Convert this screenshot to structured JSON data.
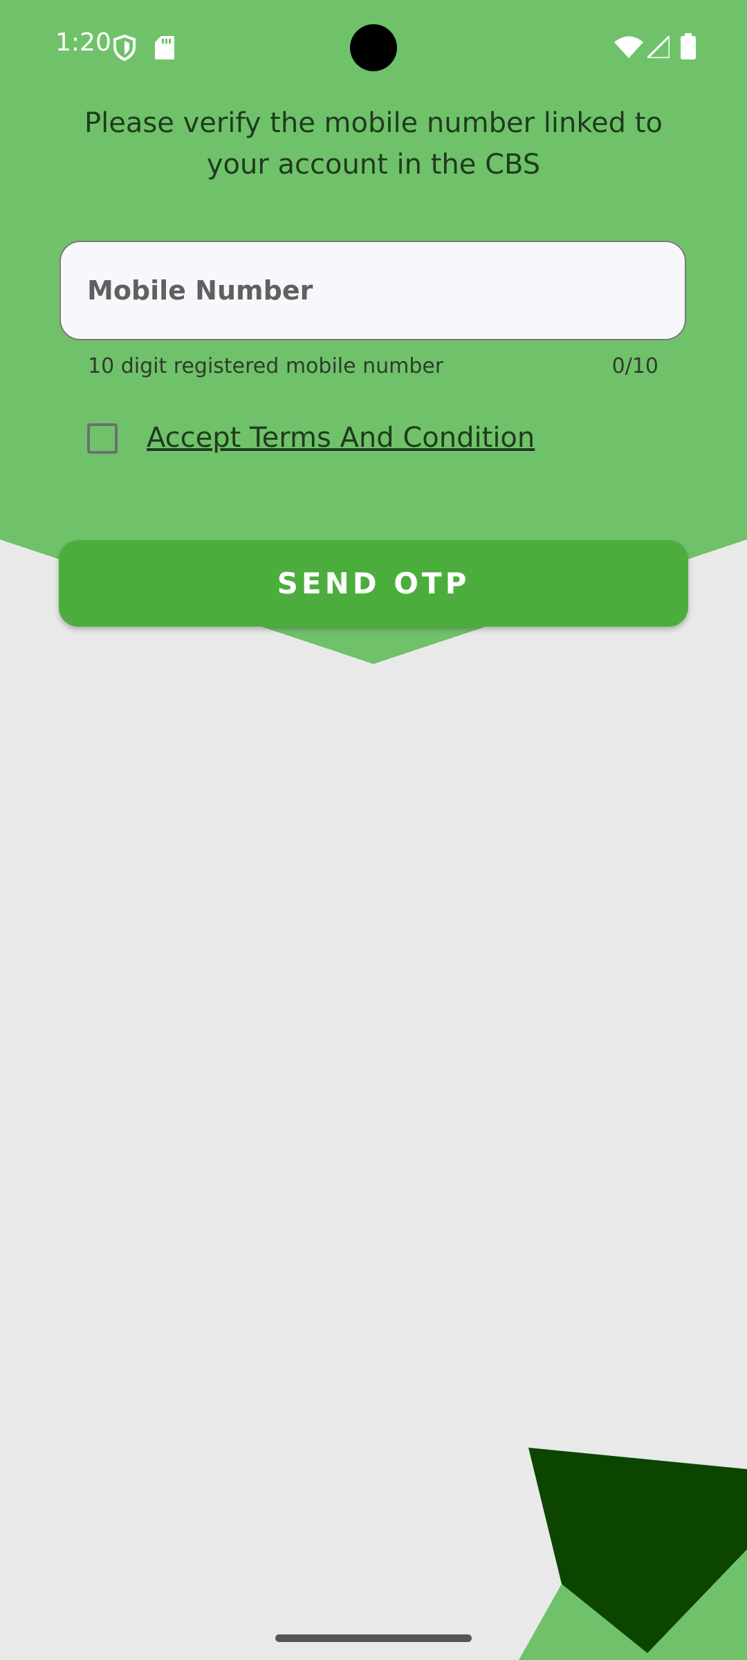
{
  "status_bar": {
    "time": "1:20",
    "left_icons": [
      "shield-icon",
      "sd-card-icon"
    ],
    "right_icons": [
      "wifi-icon",
      "signal-icon",
      "battery-icon"
    ]
  },
  "heading": "Please verify the mobile number linked to your account in the CBS",
  "mobile_field": {
    "placeholder": "Mobile Number",
    "value": "",
    "helper": "10 digit registered mobile number",
    "counter": "0/10"
  },
  "terms": {
    "checked": false,
    "label": "Accept Terms And Condition"
  },
  "send_otp_label": "SEND OTP",
  "colors": {
    "header_green": "#70C26A",
    "button_green": "#4BAE3C",
    "dark_green": "#0B4500",
    "background": "#E9E9E9",
    "text_dark": "#1F3B1E"
  }
}
